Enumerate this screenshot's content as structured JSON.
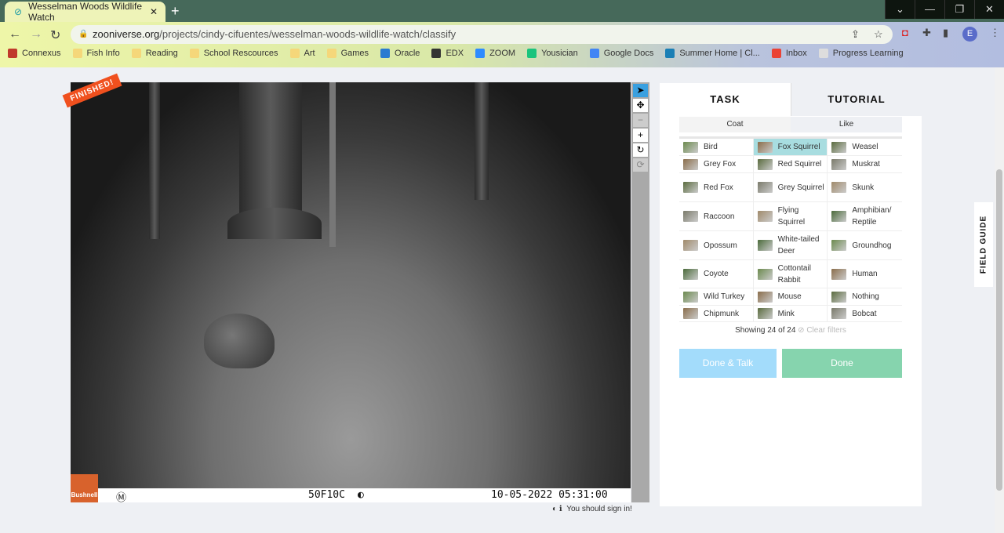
{
  "browser": {
    "tab_title": "Wesselman Woods Wildlife Watch",
    "url_domain": "zooniverse.org",
    "url_path": "/projects/cindy-cifuentes/wesselman-woods-wildlife-watch/classify",
    "profile_initial": "E",
    "bookmarks": [
      {
        "label": "Connexus",
        "color": "#c0392b"
      },
      {
        "label": "Fish Info",
        "color": "#f5d77a"
      },
      {
        "label": "Reading",
        "color": "#f5d77a"
      },
      {
        "label": "School Rescources",
        "color": "#f5d77a"
      },
      {
        "label": "Art",
        "color": "#f5d77a"
      },
      {
        "label": "Games",
        "color": "#f5d77a"
      },
      {
        "label": "Oracle",
        "color": "#2a7bd1"
      },
      {
        "label": "EDX",
        "color": "#333"
      },
      {
        "label": "ZOOM",
        "color": "#2d8cff"
      },
      {
        "label": "Yousician",
        "color": "#1bc47d"
      },
      {
        "label": "Google Docs",
        "color": "#4285f4"
      },
      {
        "label": "Summer Home | Cl...",
        "color": "#1a7fb5"
      },
      {
        "label": "Inbox",
        "color": "#ea4335"
      },
      {
        "label": "Progress Learning",
        "color": "#ddd"
      }
    ]
  },
  "viewer": {
    "badge": "FINISHED!",
    "brand": "Bushnell",
    "cam_code": "50F10C",
    "datetime": "10-05-2022 05:31:00",
    "sign_in": "You should sign in!"
  },
  "panel": {
    "tabs": [
      "TASK",
      "TUTORIAL"
    ],
    "subtabs": [
      "Coat",
      "Like"
    ],
    "species": [
      [
        "Bird",
        "Fox Squirrel",
        "Weasel"
      ],
      [
        "Grey Fox",
        "Red Squirrel",
        "Muskrat"
      ],
      [
        "Red Fox",
        "Grey Squirrel",
        "Skunk"
      ],
      [
        "Raccoon",
        "Flying Squirrel",
        "Amphibian/ Reptile"
      ],
      [
        "Opossum",
        "White-tailed Deer",
        "Groundhog"
      ],
      [
        "Coyote",
        "Cottontail Rabbit",
        "Human"
      ],
      [
        "Wild Turkey",
        "Mouse",
        "Nothing"
      ],
      [
        "Chipmunk",
        "Mink",
        "Bobcat"
      ]
    ],
    "selected": "Fox Squirrel",
    "showing": "Showing 24 of 24",
    "clear_filters": "Clear filters",
    "done_talk": "Done & Talk",
    "done": "Done",
    "field_guide": "FIELD GUIDE"
  }
}
